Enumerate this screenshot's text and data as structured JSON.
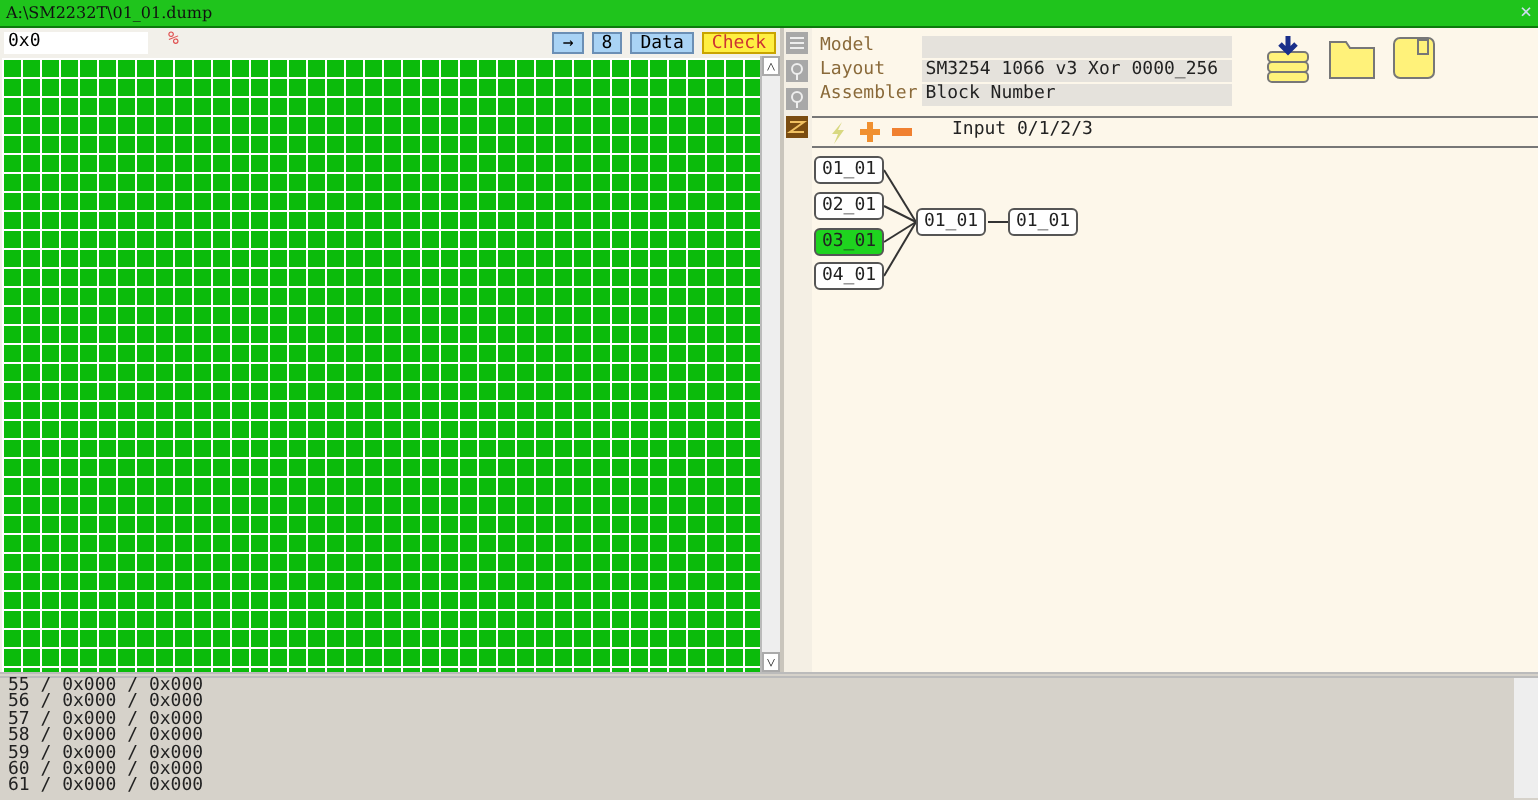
{
  "window": {
    "title": "A:\\SM2232T\\01_01.dump",
    "close": "×"
  },
  "toolbar": {
    "address": "0x0",
    "percent": "%",
    "buttons": [
      {
        "label": "→",
        "kind": "blue"
      },
      {
        "label": "8",
        "kind": "blue"
      },
      {
        "label": "Data",
        "kind": "blue"
      },
      {
        "label": "Check",
        "kind": "yellow"
      }
    ]
  },
  "scrollbar": {
    "up": "˄",
    "down": "˅"
  },
  "side_icons": [
    {
      "kind": "list",
      "selected": false
    },
    {
      "kind": "bulb",
      "selected": false
    },
    {
      "kind": "bulb",
      "selected": false
    },
    {
      "kind": "path",
      "selected": true
    }
  ],
  "properties": [
    {
      "label": "Model"
    },
    {
      "label": "Layout",
      "value": "SM3254 1066 v3 Xor 0000_256"
    },
    {
      "label": "Assembler",
      "value": "Block Number"
    }
  ],
  "graph": {
    "input_label": "Input 0/1/2/3",
    "inputs": [
      {
        "label": "01_01",
        "selected": false
      },
      {
        "label": "02_01",
        "selected": false
      },
      {
        "label": "03_01",
        "selected": true
      },
      {
        "label": "04_01",
        "selected": false
      }
    ],
    "merge": "01_01",
    "output": "01_01"
  },
  "log": [
    "55 / 0x000 / 0x000",
    "56 / 0x000 / 0x000",
    "57 / 0x000 / 0x000",
    "58 / 0x000 / 0x000",
    "59 / 0x000 / 0x000",
    "60 / 0x000 / 0x000",
    "61 / 0x000 / 0x000"
  ]
}
